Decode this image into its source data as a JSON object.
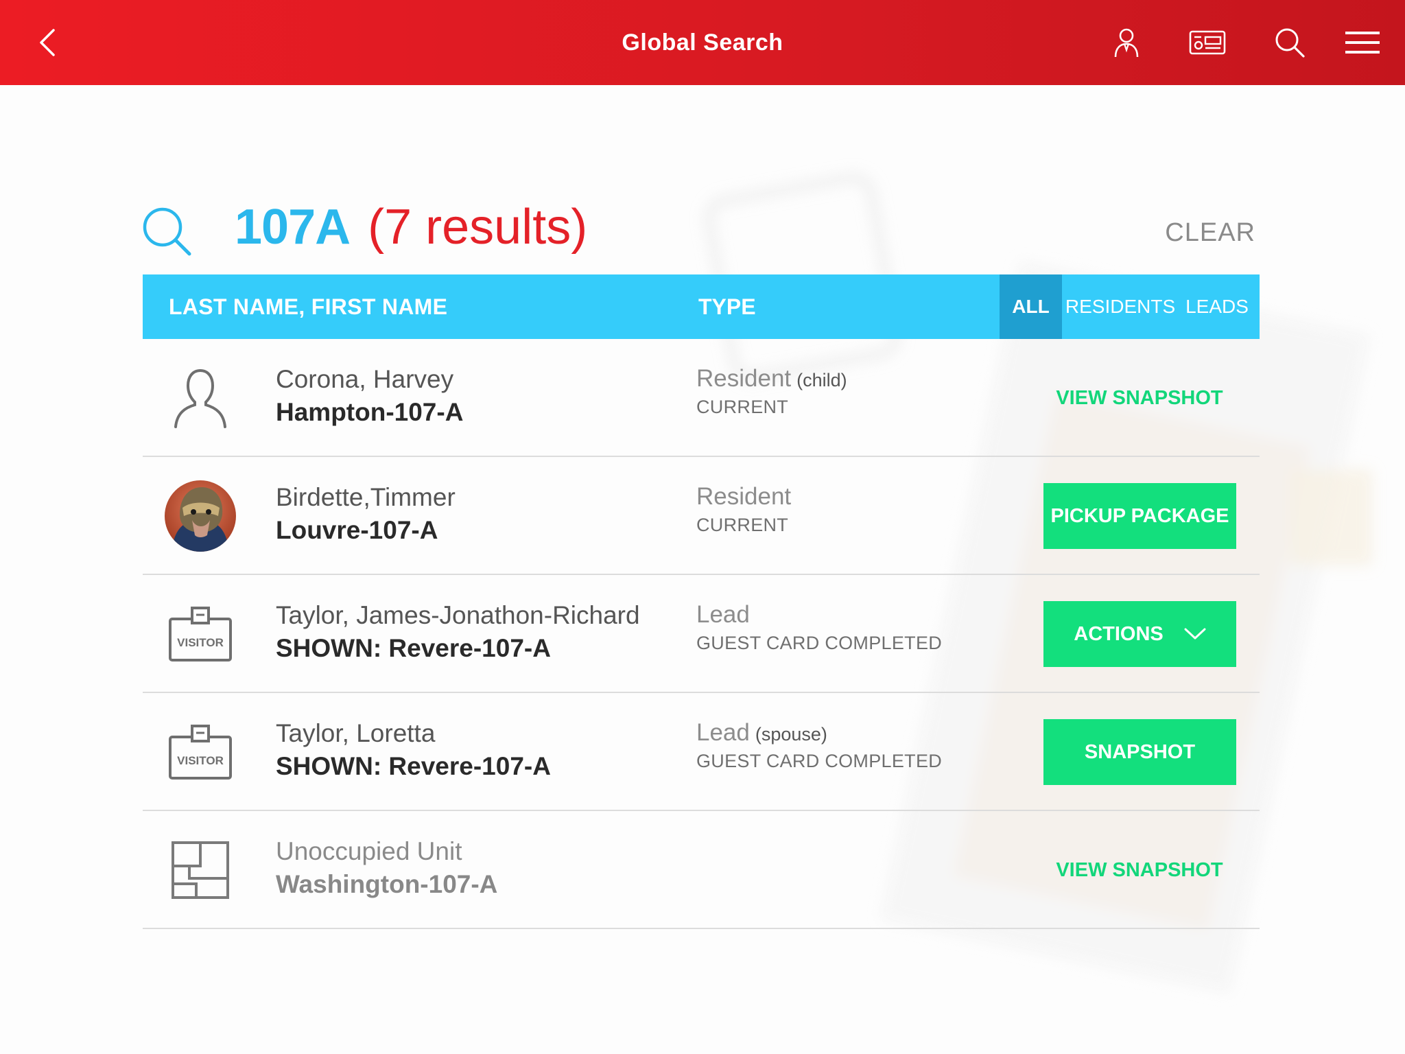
{
  "header": {
    "title": "Global Search",
    "icons": [
      "back-chevron-icon",
      "user-profile-icon",
      "id-card-icon",
      "search-icon",
      "hamburger-menu-icon"
    ]
  },
  "search": {
    "term": "107A",
    "count_label": "(7 results)",
    "clear_label": "CLEAR"
  },
  "table": {
    "columns": {
      "name": "LAST NAME, FIRST NAME",
      "type": "TYPE"
    },
    "filters": [
      {
        "label": "ALL",
        "active": true
      },
      {
        "label": "RESIDENTS",
        "active": false
      },
      {
        "label": "LEADS",
        "active": false
      }
    ],
    "rows": [
      {
        "avatar": "person-outline-icon",
        "name": "Corona, Harvey",
        "unit": "Hampton-107-A",
        "type": "Resident",
        "type_sub": "(child)",
        "status": "CURRENT",
        "action": "VIEW SNAPSHOT",
        "action_style": "link"
      },
      {
        "avatar": "user-photo",
        "name": "Birdette,Timmer",
        "unit": "Louvre-107-A",
        "type": "Resident",
        "type_sub": "",
        "status": "CURRENT",
        "action": "PICKUP PACKAGE",
        "action_style": "button"
      },
      {
        "avatar": "visitor-badge-icon",
        "avatar_label": "VISITOR",
        "name": "Taylor, James-Jonathon-Richard",
        "unit": "SHOWN: Revere-107-A",
        "type": "Lead",
        "type_sub": "",
        "status": "GUEST CARD COMPLETED",
        "action": "ACTIONS",
        "action_style": "dropdown"
      },
      {
        "avatar": "visitor-badge-icon",
        "avatar_label": "VISITOR",
        "name": "Taylor, Loretta",
        "unit": "SHOWN: Revere-107-A",
        "type": "Lead",
        "type_sub": "(spouse)",
        "status": "GUEST CARD COMPLETED",
        "action": "SNAPSHOT",
        "action_style": "button"
      },
      {
        "avatar": "floorplan-icon",
        "name": "Unoccupied Unit",
        "unit": "Washington-107-A",
        "type": "",
        "type_sub": "",
        "status": "",
        "action": "VIEW SNAPSHOT",
        "action_style": "link"
      }
    ]
  },
  "colors": {
    "header_red": "#e31b23",
    "accent_blue": "#35ccfa",
    "accent_green": "#13df7d",
    "result_red": "#e42128"
  }
}
